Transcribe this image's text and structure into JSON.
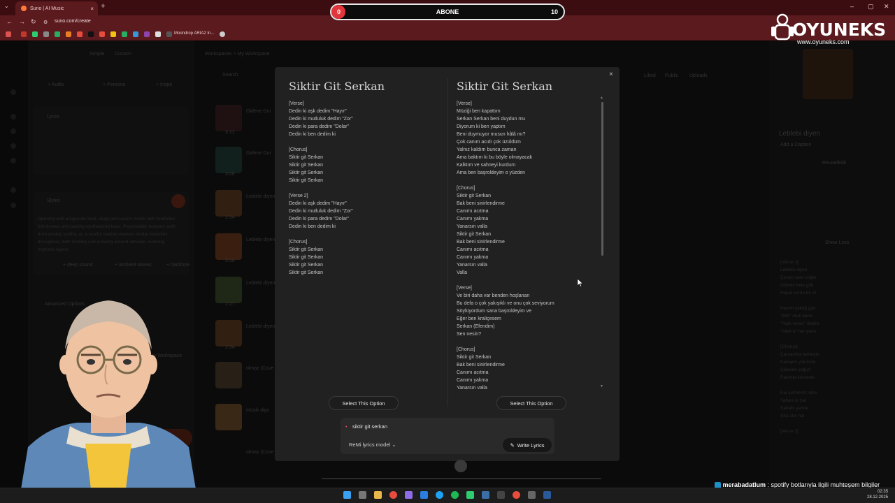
{
  "browser": {
    "tab_title": "Suno | AI Music",
    "url": "suno.com/create",
    "bookmark": "Moondrop ARIA2 In...",
    "new_tab": "+",
    "tab_close": "×",
    "tab_menu": "⌄"
  },
  "stream": {
    "sub_label": "ABONE",
    "sub_count": "0",
    "sub_goal": "10",
    "sub_progress": 0.06,
    "logo": "OYUNEKS",
    "logo_url": "www.oyuneks.com"
  },
  "background": {
    "sidebar": {
      "tab_simple": "Simple",
      "tab_custom": "Custom",
      "btn_audio": "+ Audio",
      "btn_persona": "+ Persona",
      "btn_inspo": "+ Inspo",
      "lyrics_label": "Lyrics",
      "styles_label": "Styles",
      "styles_text": "Opening with a hypnotic beat, deep percussion melds with Anatolian folk drones and pulsing synthesized bass. Psychedelic textures swirl from analog synths, as a soulful clarinet weaves modal melodies throughout, both lending and echoing around intricate, evolving rhythmic layers",
      "tags": [
        "+ deep sound",
        "+ ambient waves",
        "+ hardcore"
      ],
      "advanced": "Advanced Options",
      "workspace": "My Workspace"
    },
    "breadcrumb": "Workspaces > My Workspace",
    "search_placeholder": "Search",
    "list_items": [
      "Gidene Dur",
      "Gidene Dur",
      "Leblebi diyen",
      "Leblebi diyen",
      "Leblebi diyen",
      "Leblebi diyen",
      "olmaz (Cove",
      "müzik diyo",
      "olmaz (Cove"
    ],
    "list_times": [
      "3:11",
      "3:06",
      "2:34",
      "3:20",
      "2:27",
      "2:34",
      "",
      "",
      ""
    ],
    "filters": [
      "Liked",
      "Public",
      "Uploads"
    ],
    "right": {
      "song_title": "Leblebi diyen",
      "song_sub": "Add a Caption",
      "action": "Reuse/Edit",
      "show_less": "Show Less",
      "lyrics": [
        "[Verse 1]",
        "Leblebi diyen",
        "Çorum taso cüğer",
        "Gökten bele gidi",
        "Hayat sordu bir el",
        "",
        "Hanım çektiğ gün",
        "\"Bitti\" dedi bana",
        "\"Rahi veren\" dedim",
        "\"Allah'a\" her yana",
        "",
        "[Chorus]",
        "Çarşamba bekleyin",
        "Kanaym yükünde",
        "Çökelek yoğurt",
        "Rahmet kokunde",
        "",
        "Kal şefmeniz içine",
        "Yaban iki hal",
        "Sabahı yerine",
        "Şifa olur hal",
        "",
        "[Verse 2]"
      ]
    }
  },
  "modal": {
    "close": "×",
    "option_a": {
      "title": "Siktir Git Serkan",
      "lyrics": "[Verse]\nDedin ki aşk dedim \"Hayır\"\nDedin ki mutluluk dedim \"Zor\"\nDedin ki para dedim \"Dolar\"\nDedin ki ben dedim ki\n\n[Chorus]\nSiktir git Serkan\nSiktir git Serkan\nSiktir git Serkan\nSiktir git Serkan\n\n[Verse 2]\nDedin ki aşk dedim \"Hayır\"\nDedin ki mutluluk dedim \"Zor\"\nDedin ki para dedim \"Dolar\"\nDedin ki ben dedim ki\n\n[Chorus]\nSiktir git Serkan\nSiktir git Serkan\nSiktir git Serkan\nSiktir git Serkan",
      "select": "Select This Option"
    },
    "option_b": {
      "title": "Siktir Git Serkan",
      "lyrics": "[Verse]\nMüziği ben kapattım\nSerkan Serkan beni duydun mu\nDiyorum ki ben yaptım\nBeni duymuyor musun hâlâ mı?\nÇok canım acıdı çok üzüldüm\nYalnız kaldım bunca zaman\nAma baktım ki bu böyle olmayacak\nKalktım ve sahneyi kurdum\nAma ben başroldeyim o yüzden\n\n[Chorus]\nSiktir git Serkan\nBak beni sinirlendirme\nCanımı acıtma\nCanımı yakma\nYanarsın valla\nSiktir git Serkan\nBak beni sinirlendirme\nCanımı acıtma\nCanımı yakma\nYanarsın valla\nValla\n\n[Verse]\nVe biri daha var benden hoşlanan\nBu defa o çok yakışıklı ve onu çok seviyorum\nSöylüyordum sana başroldeyim ve\nEğer ben kraliçesem\nSerkan (Efendim)\nSen nesin?\n\n[Chorus]\nSiktir git Serkan\nBak beni sinirlendirme\nCanımı acıtma\nCanımı yakma\nYanarsın valla",
      "select": "Select This Option"
    },
    "prompt": "siktir git serkan",
    "model": "ReMi lyrics model",
    "write": "Write Lyrics"
  },
  "chat": {
    "user": "merabadatlum",
    "message": " : spotify botlarıyla ilgili muhteşem bilgiler edindim"
  },
  "clock": {
    "time": "02:35",
    "date": "28.12.2025"
  },
  "colors": {
    "accent_red": "#e2363c",
    "chrome_red": "#5a1a1e",
    "modal_bg": "#212121"
  }
}
